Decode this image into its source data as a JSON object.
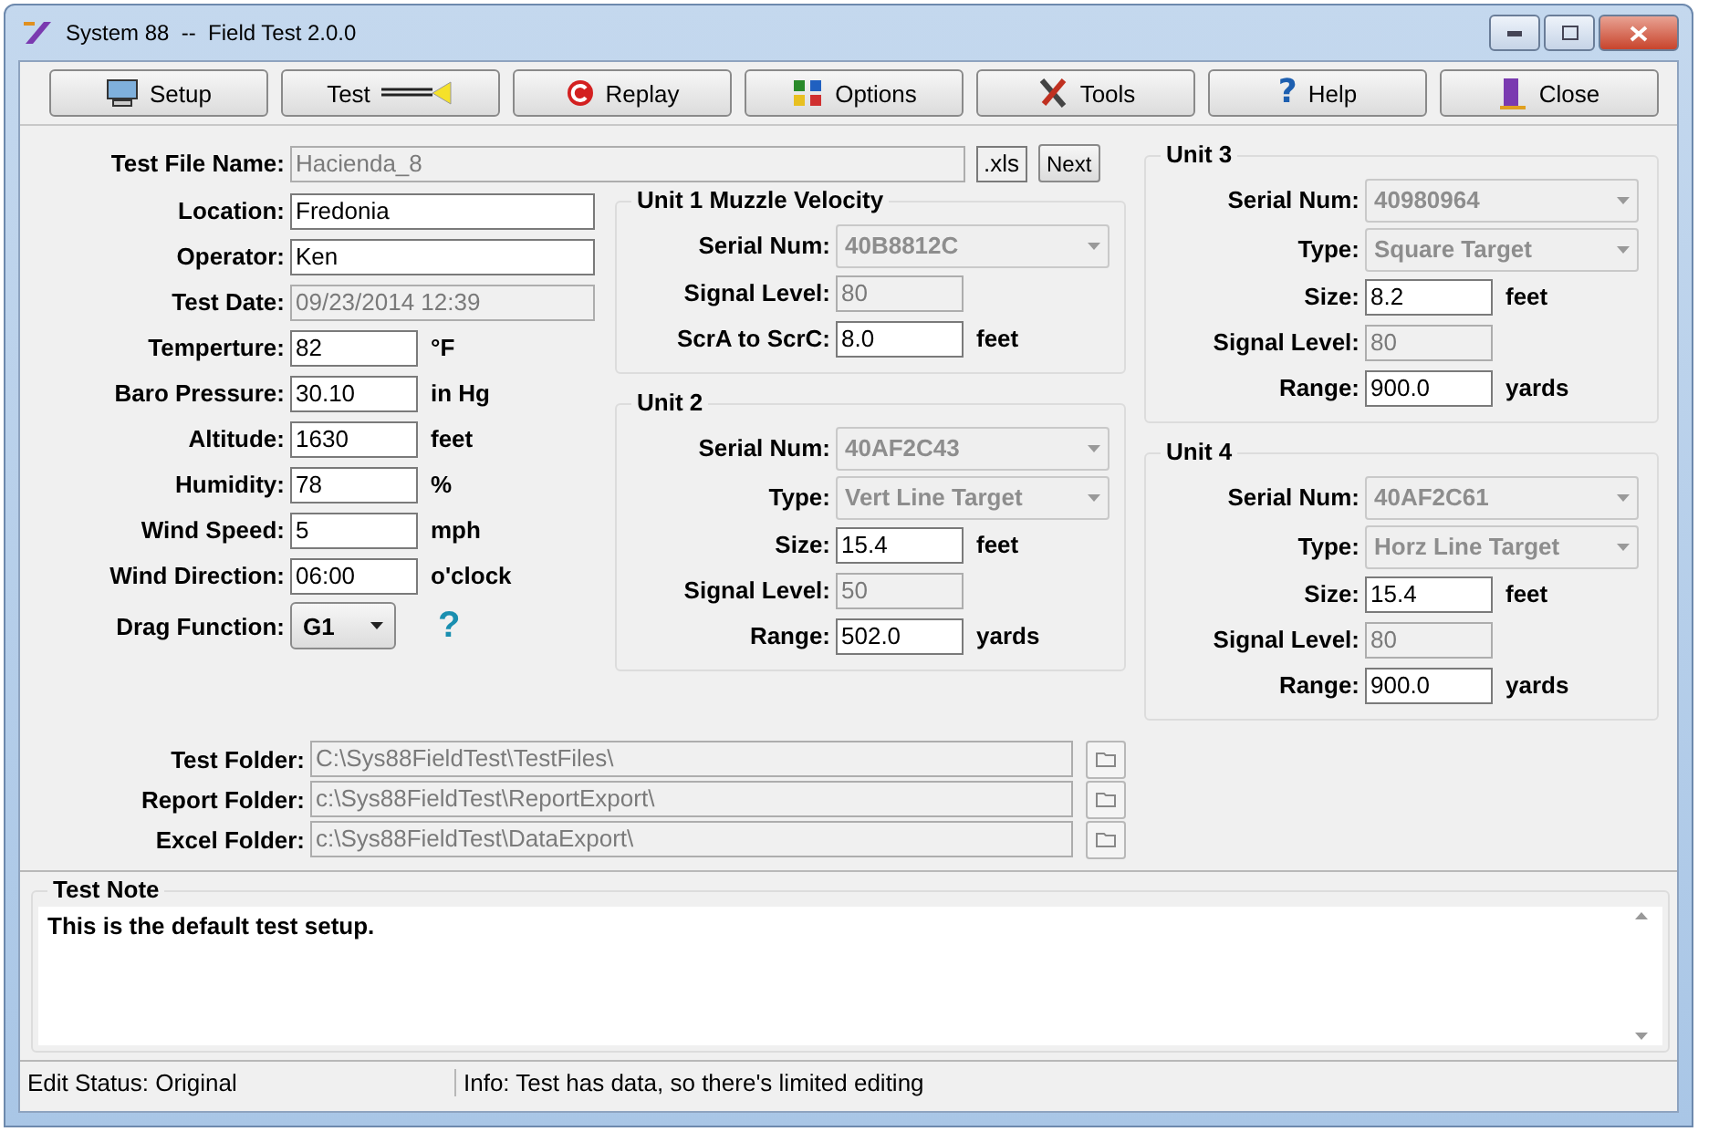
{
  "window": {
    "title": "System 88  --  Field Test 2.0.0"
  },
  "toolbar": [
    {
      "label": "Setup"
    },
    {
      "label": "Test"
    },
    {
      "label": "Replay"
    },
    {
      "label": "Options"
    },
    {
      "label": "Tools"
    },
    {
      "label": "Help",
      "glyph": "?"
    },
    {
      "label": "Close"
    }
  ],
  "test_file": {
    "label": "Test File Name:",
    "value": "Hacienda_8",
    "extension": ".xls",
    "next_button": "Next"
  },
  "fields": [
    {
      "label": "Location:",
      "value": "Fredonia",
      "kind": "text"
    },
    {
      "label": "Operator:",
      "value": "Ken",
      "kind": "text"
    },
    {
      "label": "Test Date:",
      "value": "09/23/2014 12:39",
      "kind": "readonly"
    },
    {
      "label": "Temperture:",
      "value": "82",
      "unit": "°F",
      "kind": "short"
    },
    {
      "label": "Baro Pressure:",
      "value": "30.10",
      "unit": "in Hg",
      "kind": "short"
    },
    {
      "label": "Altitude:",
      "value": "1630",
      "unit": "feet",
      "kind": "short"
    },
    {
      "label": "Humidity:",
      "value": "78",
      "unit": "%",
      "kind": "short"
    },
    {
      "label": "Wind Speed:",
      "value": "5",
      "unit": "mph",
      "kind": "short"
    },
    {
      "label": "Wind Direction:",
      "value": "06:00",
      "unit": "o'clock",
      "kind": "short"
    },
    {
      "label": "Drag Function:",
      "value": "G1",
      "kind": "dropdown",
      "help": "?"
    }
  ],
  "units": [
    {
      "title": "Unit 1 Muzzle Velocity",
      "fields": [
        {
          "label": "Serial Num:",
          "value": "40B8812C",
          "kind": "select"
        },
        {
          "label": "Signal Level:",
          "value": "80",
          "kind": "readonly"
        },
        {
          "label": "ScrA to ScrC:",
          "value": "8.0",
          "unit": "feet",
          "kind": "short"
        }
      ]
    },
    {
      "title": "Unit 2",
      "fields": [
        {
          "label": "Serial Num:",
          "value": "40AF2C43",
          "kind": "select"
        },
        {
          "label": "Type:",
          "value": "Vert Line Target",
          "kind": "select"
        },
        {
          "label": "Size:",
          "value": "15.4",
          "unit": "feet",
          "kind": "short"
        },
        {
          "label": "Signal Level:",
          "value": "50",
          "kind": "readonly"
        },
        {
          "label": "Range:",
          "value": "502.0",
          "unit": "yards",
          "kind": "short"
        }
      ]
    },
    {
      "title": "Unit 3",
      "fields": [
        {
          "label": "Serial Num:",
          "value": "40980964",
          "kind": "select"
        },
        {
          "label": "Type:",
          "value": "Square Target",
          "kind": "select"
        },
        {
          "label": "Size:",
          "value": "8.2",
          "unit": "feet",
          "kind": "short"
        },
        {
          "label": "Signal Level:",
          "value": "80",
          "kind": "readonly"
        },
        {
          "label": "Range:",
          "value": "900.0",
          "unit": "yards",
          "kind": "short"
        }
      ]
    },
    {
      "title": "Unit 4",
      "fields": [
        {
          "label": "Serial Num:",
          "value": "40AF2C61",
          "kind": "select"
        },
        {
          "label": "Type:",
          "value": "Horz Line Target",
          "kind": "select"
        },
        {
          "label": "Size:",
          "value": "15.4",
          "unit": "feet",
          "kind": "short"
        },
        {
          "label": "Signal Level:",
          "value": "80",
          "kind": "readonly"
        },
        {
          "label": "Range:",
          "value": "900.0",
          "unit": "yards",
          "kind": "short"
        }
      ]
    }
  ],
  "folders": [
    {
      "label": "Test Folder:",
      "value": "C:\\Sys88FieldTest\\TestFiles\\"
    },
    {
      "label": "Report Folder:",
      "value": "c:\\Sys88FieldTest\\ReportExport\\"
    },
    {
      "label": "Excel Folder:",
      "value": "c:\\Sys88FieldTest\\DataExport\\"
    }
  ],
  "note": {
    "title": "Test Note",
    "text": "This is the default test setup."
  },
  "status_bar": [
    "Edit Status:  Original",
    "Info:  Test has data, so there's limited editing"
  ]
}
